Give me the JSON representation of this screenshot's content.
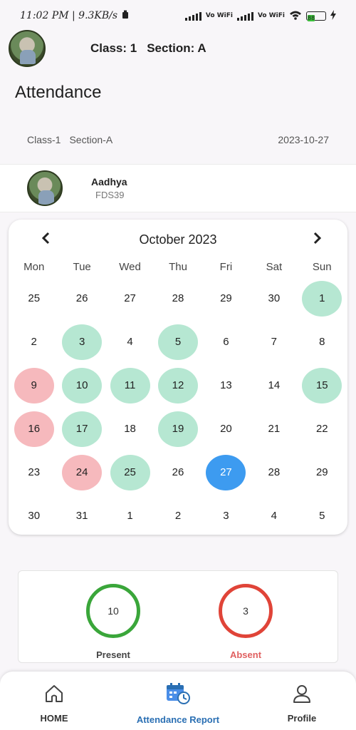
{
  "status_bar": {
    "time_speed": "11:02 PM | 9.3KB/s",
    "network1": "Vo WiFi",
    "network2": "Vo WiFi",
    "battery": "88"
  },
  "header": {
    "class_label": "Class: 1",
    "section_label": "Section: A"
  },
  "page": {
    "title": "Attendance"
  },
  "info": {
    "class": "Class-1",
    "section": "Section-A",
    "date": "2023-10-27"
  },
  "student": {
    "name": "Aadhya",
    "code": "FDS39"
  },
  "calendar": {
    "title": "October 2023",
    "prev": "‹",
    "next": "›",
    "weekdays": [
      "Mon",
      "Tue",
      "Wed",
      "Thu",
      "Fri",
      "Sat",
      "Sun"
    ],
    "days": [
      {
        "d": "25",
        "s": ""
      },
      {
        "d": "26",
        "s": ""
      },
      {
        "d": "27",
        "s": ""
      },
      {
        "d": "28",
        "s": ""
      },
      {
        "d": "29",
        "s": ""
      },
      {
        "d": "30",
        "s": ""
      },
      {
        "d": "1",
        "s": "present"
      },
      {
        "d": "2",
        "s": ""
      },
      {
        "d": "3",
        "s": "present"
      },
      {
        "d": "4",
        "s": ""
      },
      {
        "d": "5",
        "s": "present"
      },
      {
        "d": "6",
        "s": ""
      },
      {
        "d": "7",
        "s": ""
      },
      {
        "d": "8",
        "s": ""
      },
      {
        "d": "9",
        "s": "absent"
      },
      {
        "d": "10",
        "s": "present"
      },
      {
        "d": "11",
        "s": "present"
      },
      {
        "d": "12",
        "s": "present"
      },
      {
        "d": "13",
        "s": ""
      },
      {
        "d": "14",
        "s": ""
      },
      {
        "d": "15",
        "s": "present"
      },
      {
        "d": "16",
        "s": "absent"
      },
      {
        "d": "17",
        "s": "present"
      },
      {
        "d": "18",
        "s": ""
      },
      {
        "d": "19",
        "s": "present"
      },
      {
        "d": "20",
        "s": ""
      },
      {
        "d": "21",
        "s": ""
      },
      {
        "d": "22",
        "s": ""
      },
      {
        "d": "23",
        "s": ""
      },
      {
        "d": "24",
        "s": "absent"
      },
      {
        "d": "25",
        "s": "present"
      },
      {
        "d": "26",
        "s": ""
      },
      {
        "d": "27",
        "s": "today"
      },
      {
        "d": "28",
        "s": ""
      },
      {
        "d": "29",
        "s": ""
      },
      {
        "d": "30",
        "s": ""
      },
      {
        "d": "31",
        "s": ""
      },
      {
        "d": "1",
        "s": ""
      },
      {
        "d": "2",
        "s": ""
      },
      {
        "d": "3",
        "s": ""
      },
      {
        "d": "4",
        "s": ""
      },
      {
        "d": "5",
        "s": ""
      }
    ],
    "colors": {
      "present": "#b6e7d2",
      "absent": "#f6b9bd",
      "today": "#3d9bf0"
    }
  },
  "summary": {
    "present_count": "10",
    "present_label": "Present",
    "absent_count": "3",
    "absent_label": "Absent"
  },
  "nav": {
    "home": "HOME",
    "attendance": "Attendance Report",
    "profile": "Profile"
  }
}
